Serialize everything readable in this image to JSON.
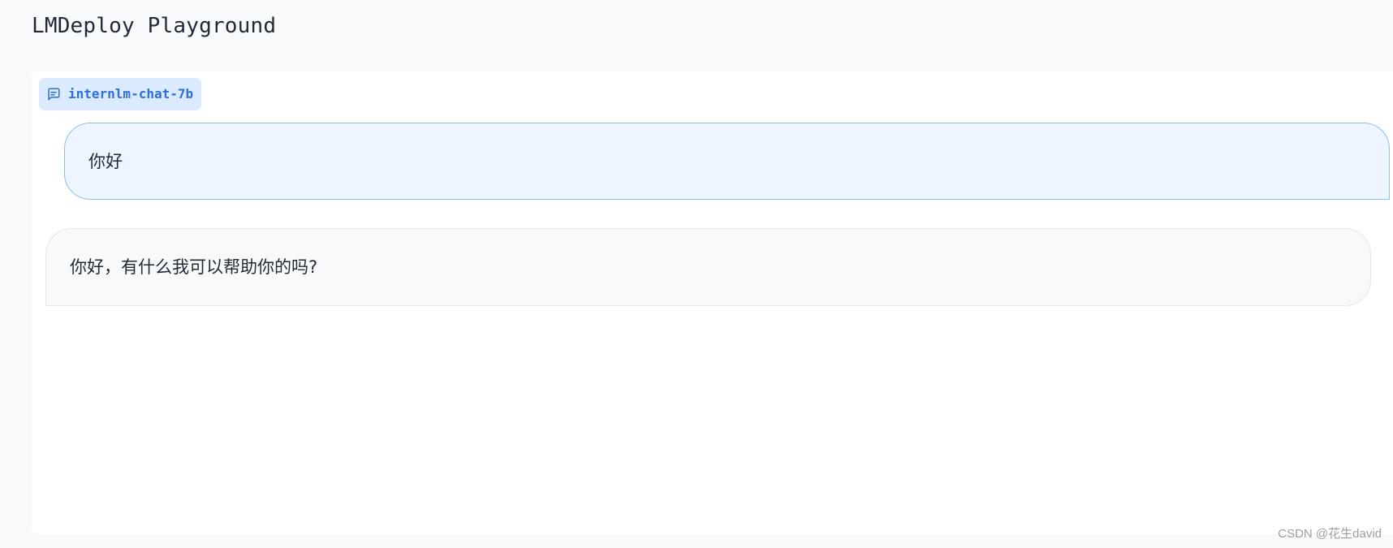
{
  "app": {
    "title": "LMDeploy Playground"
  },
  "chatbot": {
    "model_label": "internlm-chat-7b",
    "label_icon": "chat-bubble-icon",
    "messages": [
      {
        "role": "user",
        "text": "你好"
      },
      {
        "role": "assistant",
        "text": "你好，有什么我可以帮助你的吗?"
      }
    ]
  },
  "watermark": "CSDN @花生david",
  "colors": {
    "page_background": "#f8f9fb",
    "panel_background": "#ffffff",
    "label_background": "#dbeafe",
    "label_text": "#2f6fd8",
    "user_bubble_background": "#eef5ff",
    "user_bubble_border": "#8ec0ee",
    "bot_bubble_background": "#f8f9fb",
    "bot_bubble_border": "#e5e7eb"
  }
}
